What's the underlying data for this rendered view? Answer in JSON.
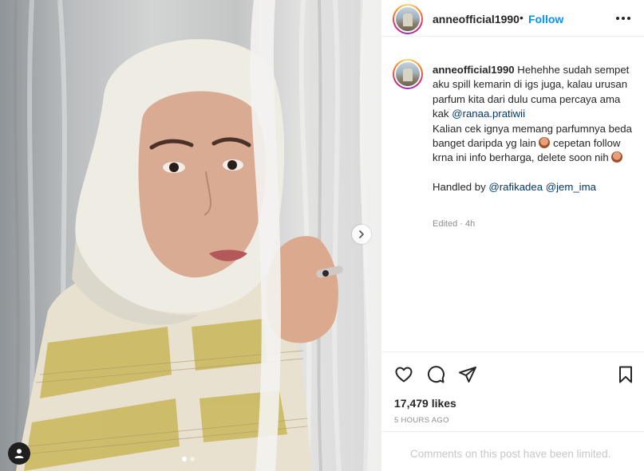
{
  "post": {
    "username": "anneofficial1990",
    "follow_label": "Follow",
    "separator": "•",
    "caption": {
      "part1": " Hehehhe sudah sempet aku spill kemarin di igs juga, kalau urusan parfum kita dari dulu cuma percaya ama kak ",
      "mention1": "@ranaa.pratiwii",
      "part2": "\nKalian cek ignya memang parfumnya beda banget daripda yg lain ",
      "part3": " cepetan follow krna ini info berharga, delete soon nih ",
      "part4": "\n\nHandled by ",
      "mention2": "@rafikadea",
      "mention3": "@jem_ima"
    },
    "edited_label": "Edited · 4h",
    "likes_label": "17,479 likes",
    "time_label": "5 HOURS AGO",
    "comments_limited": "Comments on this post have been limited."
  },
  "carousel": {
    "current_index": 1,
    "total": 2
  },
  "icons": {
    "more": "more-horizontal-icon",
    "like": "heart-icon",
    "comment": "comment-bubble-icon",
    "share": "paper-plane-icon",
    "save": "bookmark-icon",
    "next": "chevron-right-icon",
    "user_tag": "person-icon",
    "emoji": "person-facepalm-emoji"
  },
  "colors": {
    "accent": "#0095f6",
    "mention": "#00376b",
    "muted": "#8e8e8e",
    "text": "#262626"
  }
}
